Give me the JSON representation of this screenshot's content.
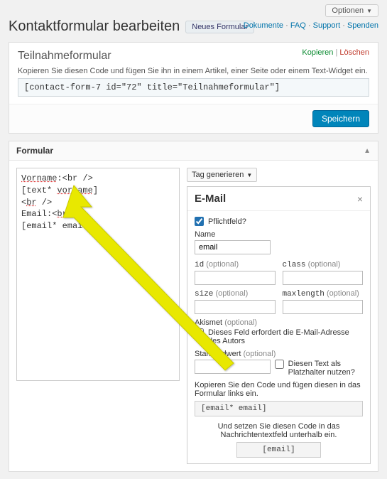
{
  "topbar": {
    "options": "Optionen",
    "help_links": {
      "doc": "Dokumente",
      "faq": "FAQ",
      "support": "Support",
      "donate": "Spenden"
    }
  },
  "page": {
    "title": "Kontaktformular bearbeiten",
    "new_form": "Neues Formular"
  },
  "panel1": {
    "title": "Teilnahmeformular",
    "copy": "Kopieren",
    "delete": "Löschen",
    "desc": "Kopieren Sie diesen Code und fügen Sie ihn in einem Artikel, einer Seite oder einem Text-Widget ein.",
    "shortcode": "[contact-form-7 id=\"72\" title=\"Teilnahmeformular\"]",
    "save": "Speichern"
  },
  "section": {
    "title": "Formular",
    "editor_lines": [
      "Vorname:<br />",
      "[text* vorname]",
      "<br />",
      "Email:<br />",
      "[email* email]"
    ]
  },
  "gen": {
    "dropdown": "Tag generieren",
    "title": "E-Mail",
    "required_label": "Pflichtfeld?",
    "required_checked": true,
    "name_label": "Name",
    "name_value": "email",
    "id_label": "id",
    "class_label": "class",
    "size_label": "size",
    "maxlength_label": "maxlength",
    "optional": "(optional)",
    "akismet_label": "Akismet",
    "akismet_desc": "Dieses Feld erfordert die E-Mail-Adresse des Autors",
    "default_label": "Standardwert",
    "placeholder_desc": "Diesen Text als Platzhalter nutzen?",
    "copy_desc": "Kopieren Sie den Code und fügen diesen in das Formular links ein.",
    "code1": "[email* email]",
    "msg_desc": "Und setzen Sie diesen Code in das Nachrichtentextfeld unterhalb ein.",
    "code2": "[email]"
  }
}
